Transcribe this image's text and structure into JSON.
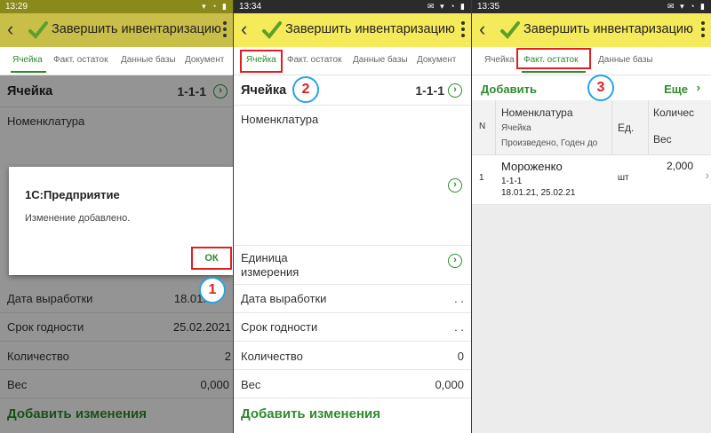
{
  "screens": [
    {
      "status_time": "13:29",
      "title": "Завершить инвентаризацию",
      "tabs": [
        "Ячейка",
        "Факт. остаток",
        "Данные базы",
        "Документ"
      ],
      "cell_label": "Ячейка",
      "cell_value": "1-1-1",
      "nomenclature_label": "Номенклатура",
      "dialog": {
        "title": "1С:Предприятие",
        "message": "Изменение добавлено.",
        "ok_label": "ОК"
      },
      "rows": [
        {
          "label": "Дата выработки",
          "value": "18.01."
        },
        {
          "label": "Срок годности",
          "value": "25.02.2021"
        },
        {
          "label": "Количество",
          "value": "2"
        },
        {
          "label": "Вес",
          "value": "0,000"
        }
      ],
      "add_changes": "Добавить изменения",
      "marker": "1"
    },
    {
      "status_time": "13:34",
      "title": "Завершить инвентаризацию",
      "tabs": [
        "Ячейка",
        "Факт. остаток",
        "Данные базы",
        "Документ"
      ],
      "cell_label": "Ячейка",
      "cell_value": "1-1-1",
      "nomenclature_label": "Номенклатура",
      "unit_label": "Единица измерения",
      "rows": [
        {
          "label": "Дата выработки",
          "value": ". ."
        },
        {
          "label": "Срок годности",
          "value": ". ."
        },
        {
          "label": "Количество",
          "value": "0"
        },
        {
          "label": "Вес",
          "value": "0,000"
        }
      ],
      "add_changes": "Добавить изменения",
      "marker": "2"
    },
    {
      "status_time": "13:35",
      "title": "Завершить инвентаризацию",
      "tabs": [
        "Ячейка",
        "Факт. остаток",
        "Данные базы"
      ],
      "add_label": "Добавить",
      "more_label": "Еще",
      "table": {
        "col_n": "N",
        "col_nom": "Номенклатура",
        "col_nom_sub1": "Ячейка",
        "col_nom_sub2": "Произведено, Годен до",
        "col_unit": "Ед.",
        "col_qty": "Количес",
        "col_weight": "Вес",
        "row": {
          "n": "1",
          "name": "Мороженко",
          "cell": "1-1-1",
          "dates": "18.01.21, 25.02.21",
          "unit": "шт",
          "qty": "2,000"
        }
      },
      "marker": "3"
    }
  ],
  "colors": {
    "appbar": "#f5ea5a",
    "accent": "#2e8b2e",
    "highlight": "#e02020",
    "marker_ring": "#2aa3e0"
  }
}
